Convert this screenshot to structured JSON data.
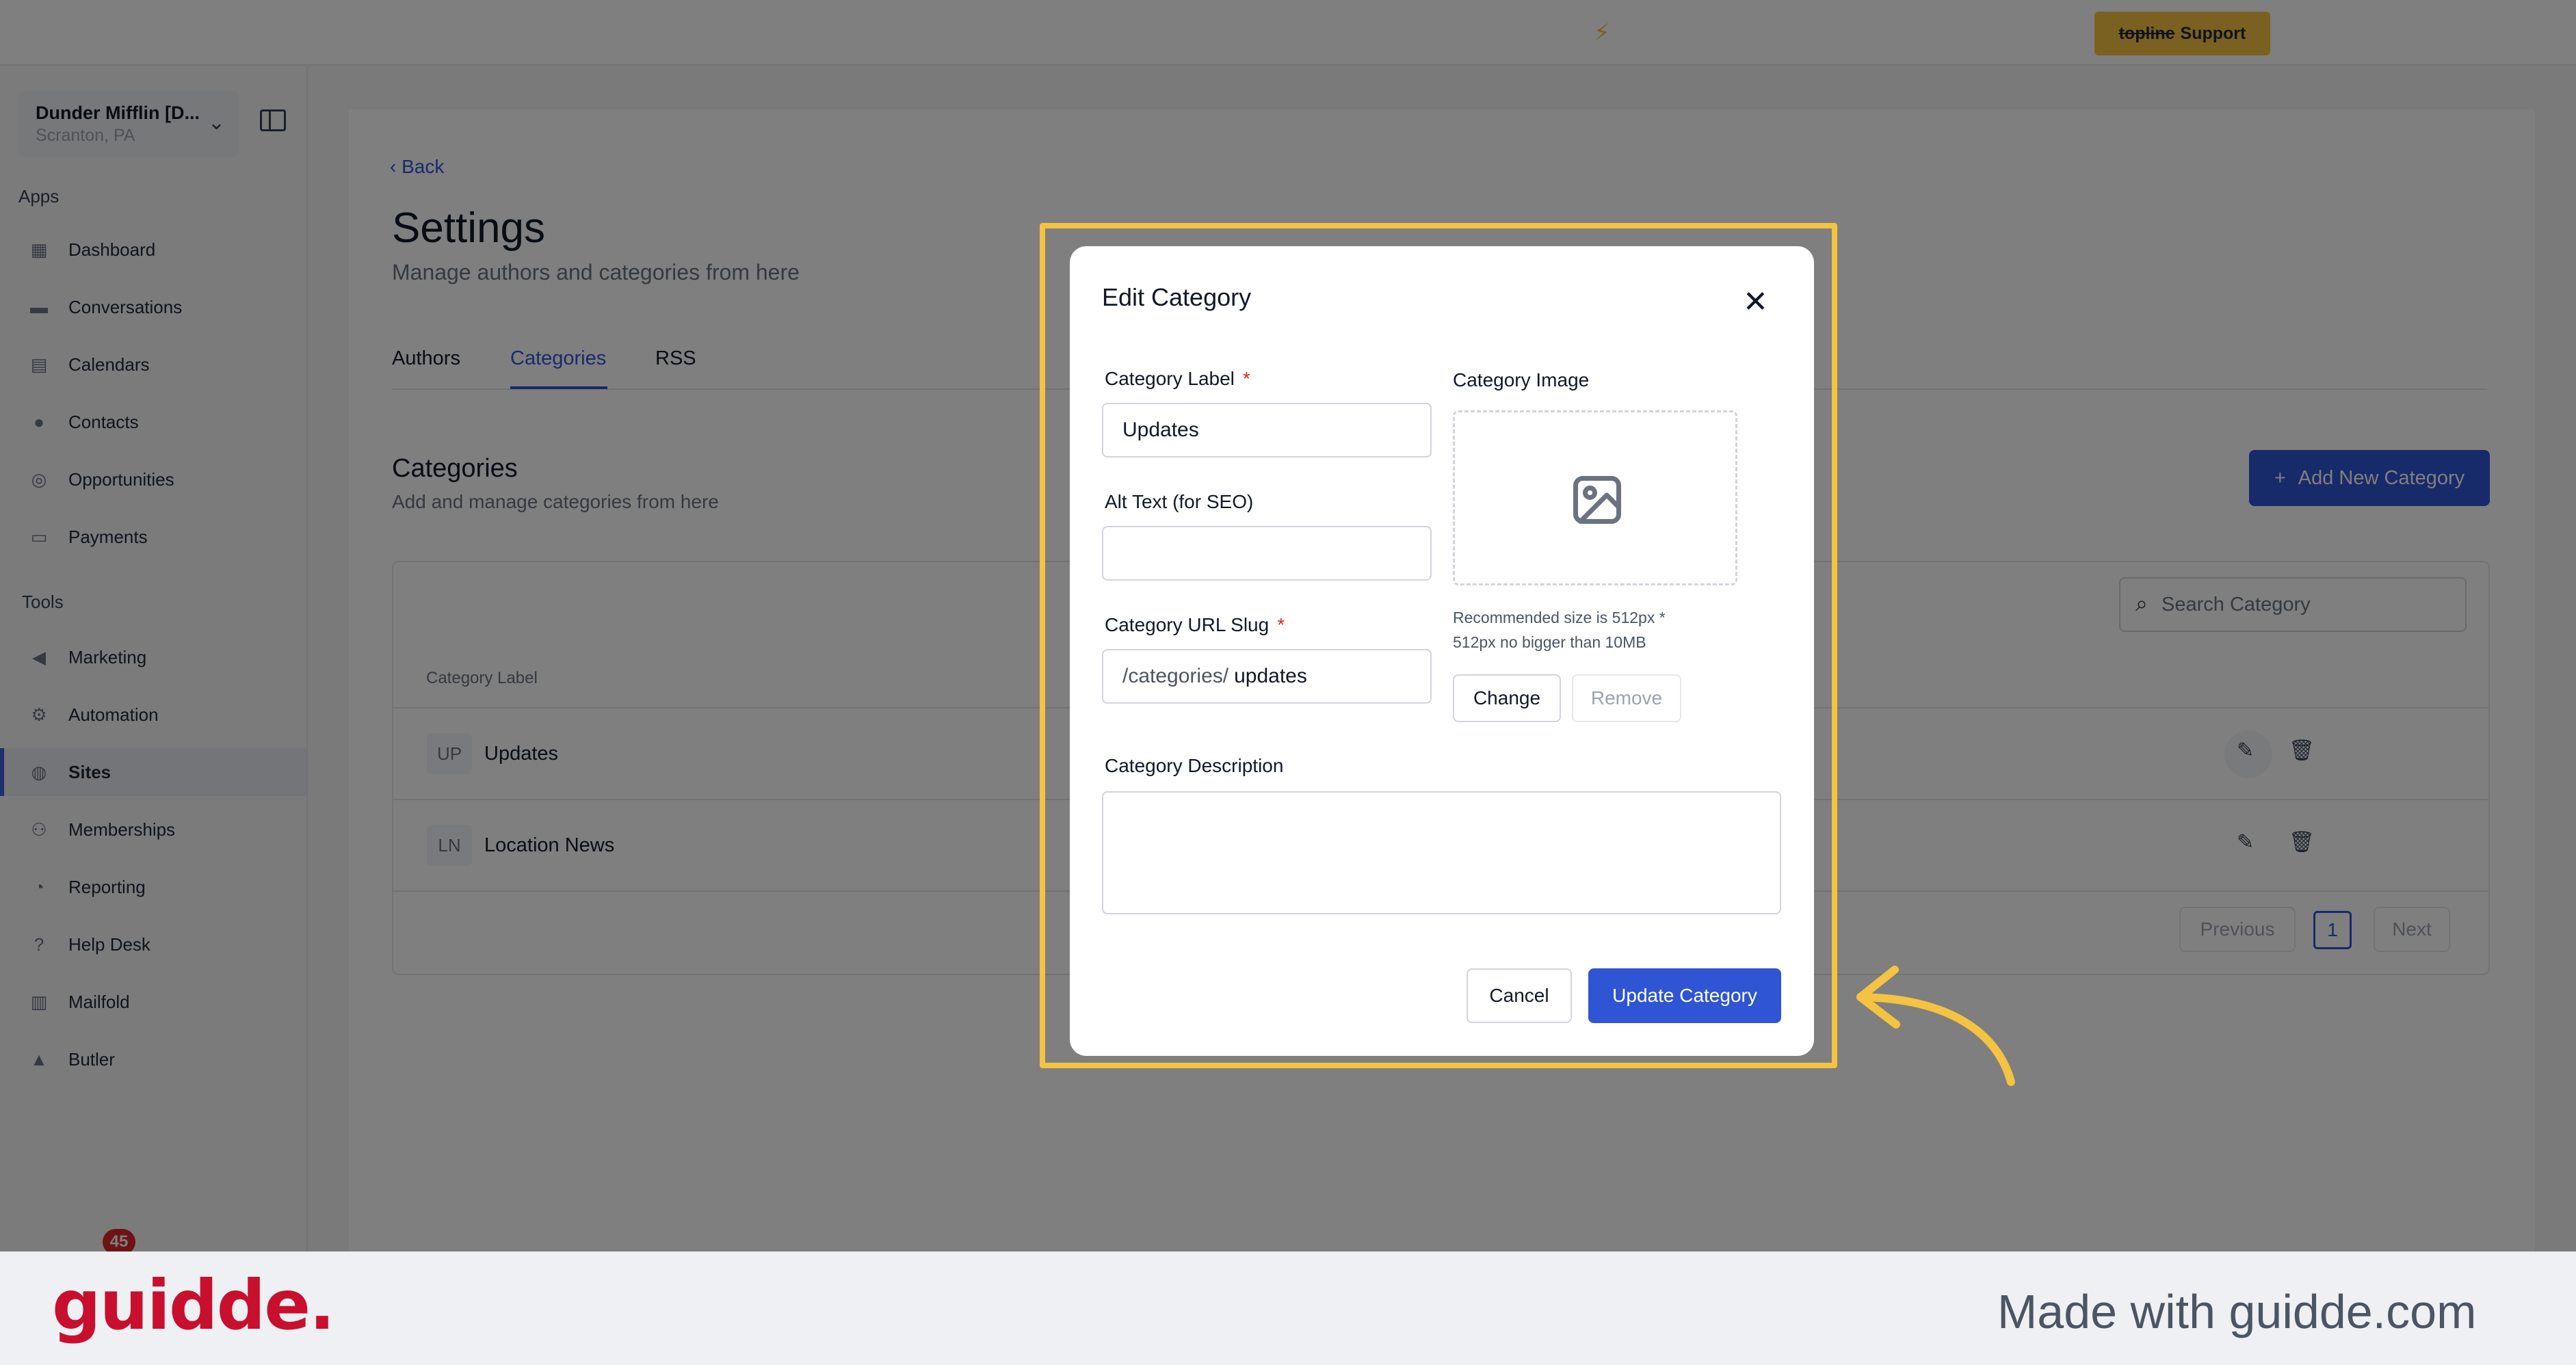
{
  "topbar": {
    "support": {
      "strike": "topline",
      "label": "Support"
    }
  },
  "account": {
    "name": "Dunder Mifflin [D...",
    "location": "Scranton, PA"
  },
  "sidebar": {
    "apps_label": "Apps",
    "tools_label": "Tools",
    "apps": [
      {
        "label": "Dashboard",
        "icon": "dashboard-icon"
      },
      {
        "label": "Conversations",
        "icon": "chat-icon"
      },
      {
        "label": "Calendars",
        "icon": "calendar-icon"
      },
      {
        "label": "Contacts",
        "icon": "person-icon"
      },
      {
        "label": "Opportunities",
        "icon": "target-icon"
      },
      {
        "label": "Payments",
        "icon": "card-icon"
      }
    ],
    "tools": [
      {
        "label": "Marketing",
        "icon": "megaphone-icon"
      },
      {
        "label": "Automation",
        "icon": "gears-icon"
      },
      {
        "label": "Sites",
        "icon": "globe-icon",
        "active": true
      },
      {
        "label": "Memberships",
        "icon": "users-icon"
      },
      {
        "label": "Reporting",
        "icon": "pie-icon"
      },
      {
        "label": "Help Desk",
        "icon": "help-icon"
      },
      {
        "label": "Mailfold",
        "icon": "mail-icon"
      },
      {
        "label": "Butler",
        "icon": "butler-icon"
      }
    ],
    "badge_count": "45"
  },
  "page": {
    "back": "Back",
    "title": "Settings",
    "subtitle": "Manage authors and categories from here",
    "tabs": [
      "Authors",
      "Categories",
      "RSS"
    ],
    "categories_title": "Categories",
    "categories_sub": "Add and manage categories from here",
    "add_button": "Add New Category",
    "search_placeholder": "Search Category",
    "table_header": "Category Label",
    "rows": [
      {
        "badge": "UP",
        "label": "Updates"
      },
      {
        "badge": "LN",
        "label": "Location News"
      }
    ],
    "pager": {
      "prev": "Previous",
      "current": "1",
      "next": "Next"
    }
  },
  "modal": {
    "title": "Edit Category",
    "label_field": {
      "label": "Category Label",
      "required": "*",
      "value": "Updates"
    },
    "alt_field": {
      "label": "Alt Text (for SEO)",
      "value": ""
    },
    "slug_field": {
      "label": "Category URL Slug",
      "required": "*",
      "prefix": "/categories/",
      "value": "updates"
    },
    "image_field": {
      "label": "Category Image",
      "hint1": "Recommended size is 512px *",
      "hint2": "512px no bigger than 10MB",
      "change": "Change",
      "remove": "Remove"
    },
    "description_label": "Category Description",
    "cancel": "Cancel",
    "update": "Update Category"
  },
  "footer": {
    "logo": "guidde.",
    "made_with": "Made with guidde.com"
  },
  "colors": {
    "accent": "#2f55d4",
    "highlight": "#f5c342",
    "brand": "#c8102e"
  }
}
